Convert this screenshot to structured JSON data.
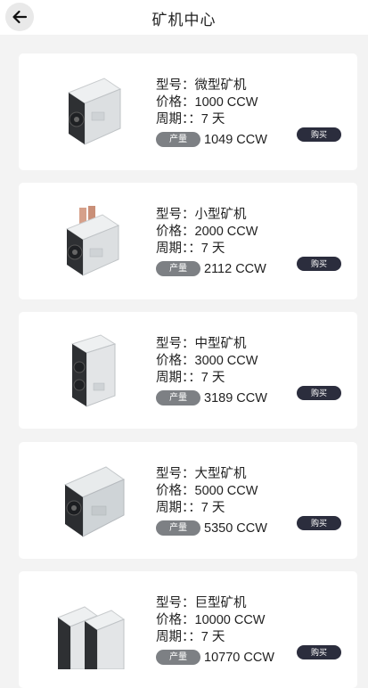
{
  "header": {
    "title": "矿机中心",
    "back_icon": "arrow-left-icon"
  },
  "labels": {
    "output_badge": "产量",
    "buy_button": "购买"
  },
  "colors": {
    "buy_button_bg": "#2b2d3d",
    "badge_bg": "#7d8084",
    "page_bg": "#f3f3f3"
  },
  "miners": [
    {
      "model_line": "型号：微型矿机",
      "price_line": "价格：1000 CCW",
      "period_line": "周期：：7 天",
      "output_value": "1049 CCW",
      "image_icon": "mining-machine-image"
    },
    {
      "model_line": "型号：小型矿机",
      "price_line": "价格：2000 CCW",
      "period_line": "周期：：7 天",
      "output_value": "2112 CCW",
      "image_icon": "mining-machine-image"
    },
    {
      "model_line": "型号：中型矿机",
      "price_line": "价格：3000 CCW",
      "period_line": "周期：：7 天",
      "output_value": "3189 CCW",
      "image_icon": "mining-machine-image"
    },
    {
      "model_line": "型号：大型矿机",
      "price_line": "价格：5000 CCW",
      "period_line": "周期：：7 天",
      "output_value": "5350 CCW",
      "image_icon": "mining-machine-image"
    },
    {
      "model_line": "型号：巨型矿机",
      "price_line": "价格：10000 CCW",
      "period_line": "周期：：7 天",
      "output_value": "10770 CCW",
      "image_icon": "mining-machine-image"
    }
  ]
}
